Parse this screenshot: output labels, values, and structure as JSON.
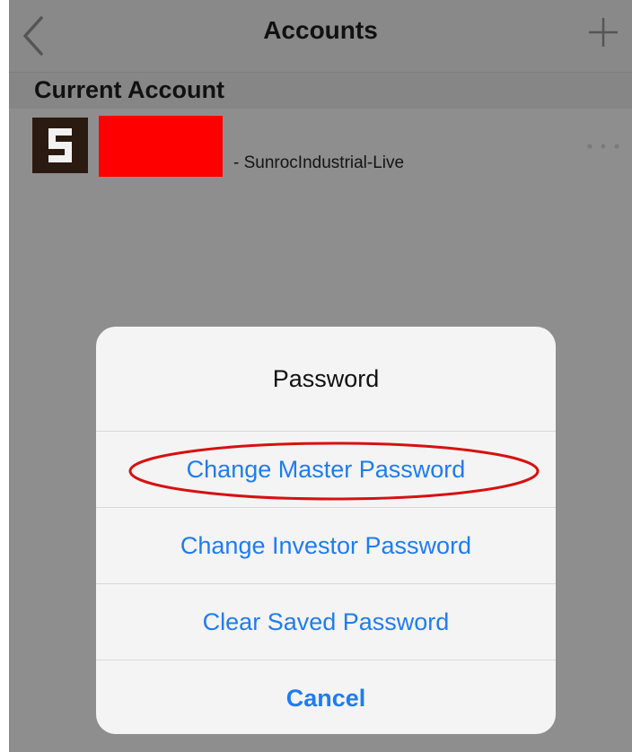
{
  "navbar": {
    "title": "Accounts",
    "back_icon": "chevron-left-icon",
    "add_icon": "plus-icon"
  },
  "current_account": {
    "section_title": "Current Account",
    "logo_icon": "account-s-logo",
    "server": "- SunrocIndustrial-Live",
    "more_icon": "more-dots-icon"
  },
  "modal": {
    "title": "Password",
    "options": [
      {
        "label": "Change Master Password"
      },
      {
        "label": "Change Investor Password"
      },
      {
        "label": "Clear Saved Password"
      }
    ],
    "cancel": "Cancel"
  },
  "colors": {
    "link": "#1e7cf2",
    "overlay": "#8e8e8e",
    "highlight": "#d81010",
    "redaction": "#ff0000"
  }
}
